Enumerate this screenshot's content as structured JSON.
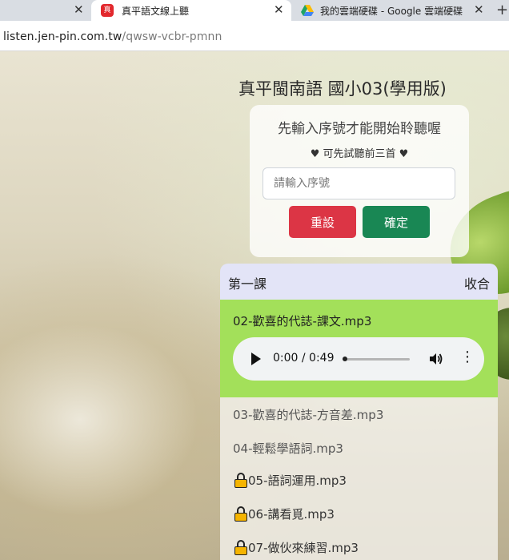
{
  "browser": {
    "tabs": [
      {
        "title": ""
      },
      {
        "title": "真平語文線上聽",
        "favicon_text": "真平"
      },
      {
        "title": "我的雲端硬碟 - Google 雲端硬碟"
      }
    ],
    "new_tab_symbol": "+",
    "url": {
      "host": "listen.jen-pin.com.tw",
      "path": "/qwsw-vcbr-pmnn"
    }
  },
  "page": {
    "title": "真平閩南語 國小03(學用版)",
    "unlock": {
      "prompt": "先輸入序號才能開始聆聽喔",
      "hint": "♥ 可先試聽前三首 ♥",
      "serial_placeholder": "請輸入序號",
      "reset_label": "重設",
      "confirm_label": "確定"
    },
    "lesson": {
      "name": "第一課",
      "collapse_label": "收合",
      "active_track": "02-歡喜的代誌-課文.mp3",
      "player": {
        "time": "0:00 / 0:49",
        "progress": 0
      },
      "tracks": [
        {
          "name": "03-歡喜的代誌-方音差.mp3",
          "locked": false
        },
        {
          "name": "04-輕鬆學語詞.mp3",
          "locked": false
        },
        {
          "name": "05-語詞運用.mp3",
          "locked": true
        },
        {
          "name": "06-講看覓.mp3",
          "locked": true
        },
        {
          "name": "07-做伙來練習.mp3",
          "locked": true
        }
      ]
    }
  },
  "colors": {
    "reset": "#dc3545",
    "confirm": "#198754",
    "active_track_bg": "#a3e05a",
    "lesson_header_bg": "#e3e4f7",
    "lock": "#f5b400"
  }
}
